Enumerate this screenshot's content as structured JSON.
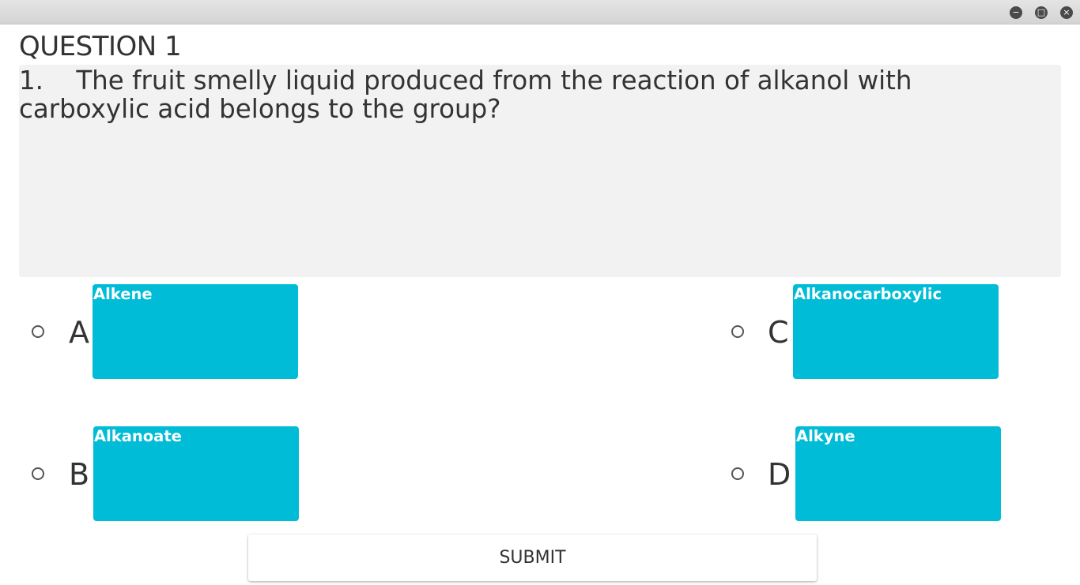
{
  "window": {
    "controls": [
      {
        "name": "minimize-icon",
        "glyph": "−"
      },
      {
        "name": "maximize-icon",
        "glyph": "□"
      },
      {
        "name": "close-icon",
        "glyph": "×"
      }
    ]
  },
  "question": {
    "heading": "QUESTION 1",
    "text": "1.    The fruit smelly liquid produced from the reaction of alkanol with carboxylic acid belongs to the group?"
  },
  "options": [
    {
      "letter": "A",
      "label": "Alkene",
      "selected": false
    },
    {
      "letter": "B",
      "label": "Alkanoate",
      "selected": false
    },
    {
      "letter": "C",
      "label": "Alkanocarboxylic",
      "selected": false
    },
    {
      "letter": "D",
      "label": "Alkyne",
      "selected": false
    }
  ],
  "submit": {
    "label": "SUBMIT"
  },
  "colors": {
    "option_card": "#00bcd6",
    "question_box": "#f2f2f2"
  }
}
